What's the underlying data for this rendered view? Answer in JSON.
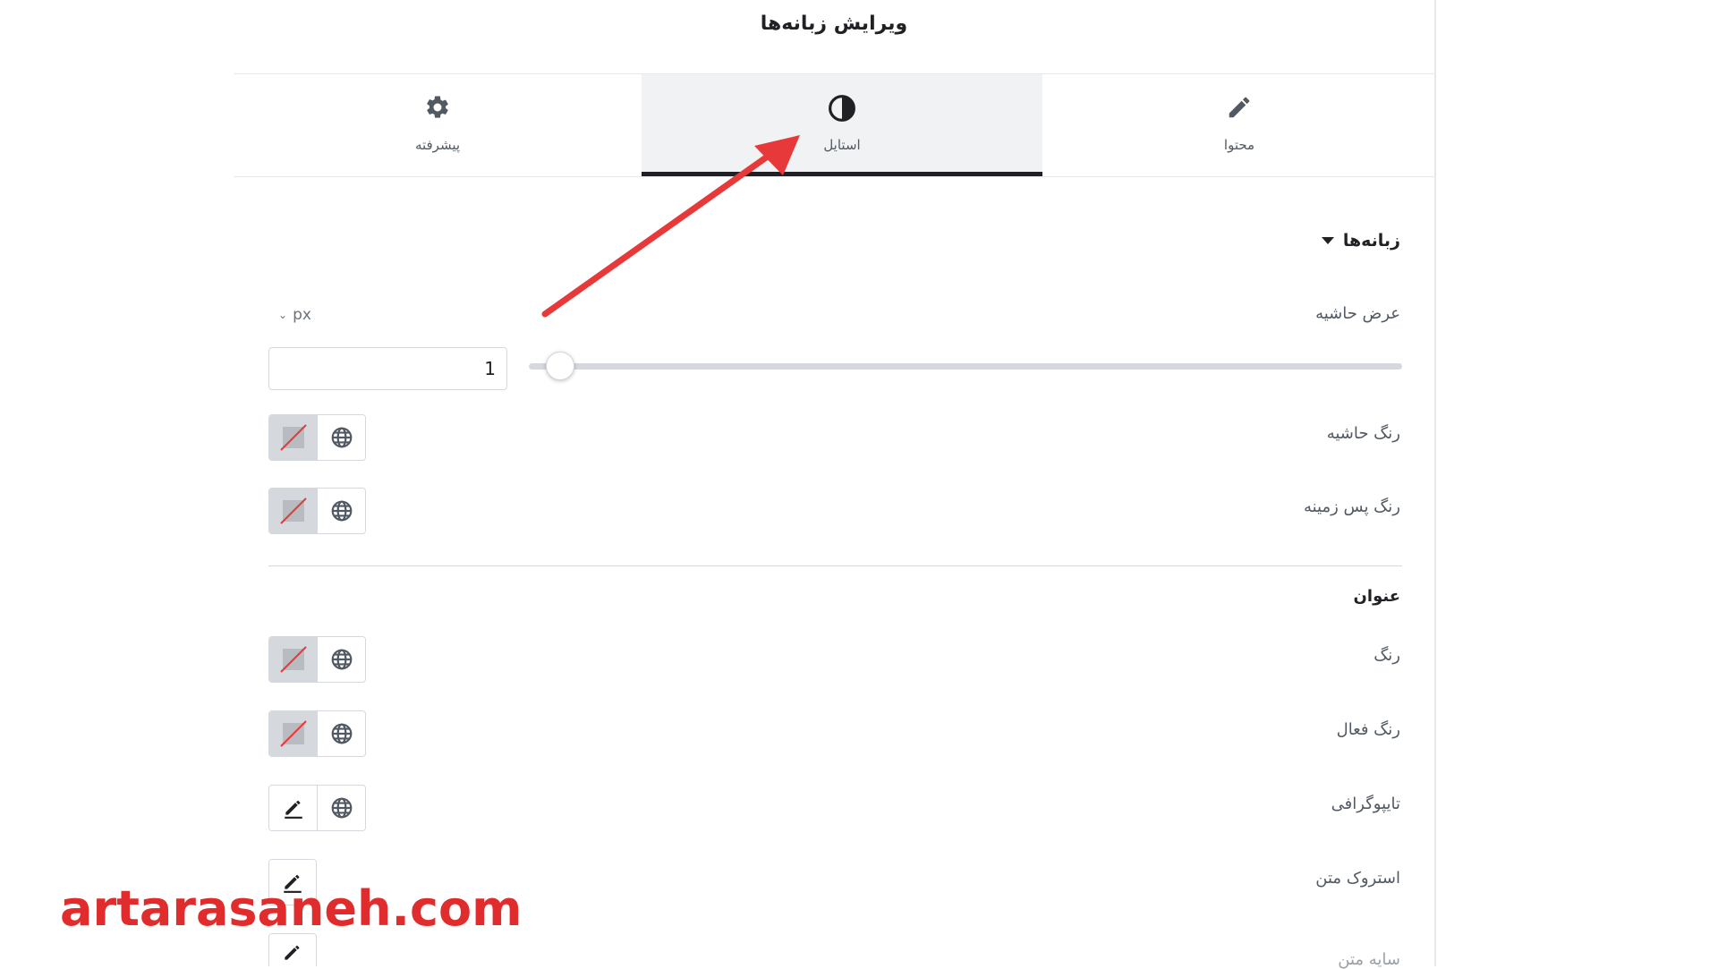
{
  "panel": {
    "title": "ویرایش زبانه‌ها"
  },
  "tabs": [
    {
      "label": "پیشرفته",
      "icon": "gear-icon"
    },
    {
      "label": "استایل",
      "icon": "half-circle-icon",
      "active": true
    },
    {
      "label": "محتوا",
      "icon": "pencil-icon"
    }
  ],
  "section": {
    "title": "زبانه‌ها"
  },
  "border_width": {
    "label": "عرض حاشیه",
    "unit": "px",
    "value": "1",
    "slider_fraction": 0.02
  },
  "border_color": {
    "label": "رنگ حاشیه"
  },
  "background_color": {
    "label": "رنگ پس زمینه"
  },
  "title_section": {
    "label": "عنوان"
  },
  "color": {
    "label": "رنگ"
  },
  "active_color": {
    "label": "رنگ فعال"
  },
  "typography": {
    "label": "تایپوگرافی"
  },
  "text_stroke": {
    "label": "استروک متن"
  },
  "text_shadow": {
    "label": "سایه متن"
  },
  "watermark": {
    "text": "artarasaneh.com"
  },
  "colors": {
    "accent": "#1f2124",
    "arrow": "#e8393a",
    "watermark": "#e02c2c"
  }
}
